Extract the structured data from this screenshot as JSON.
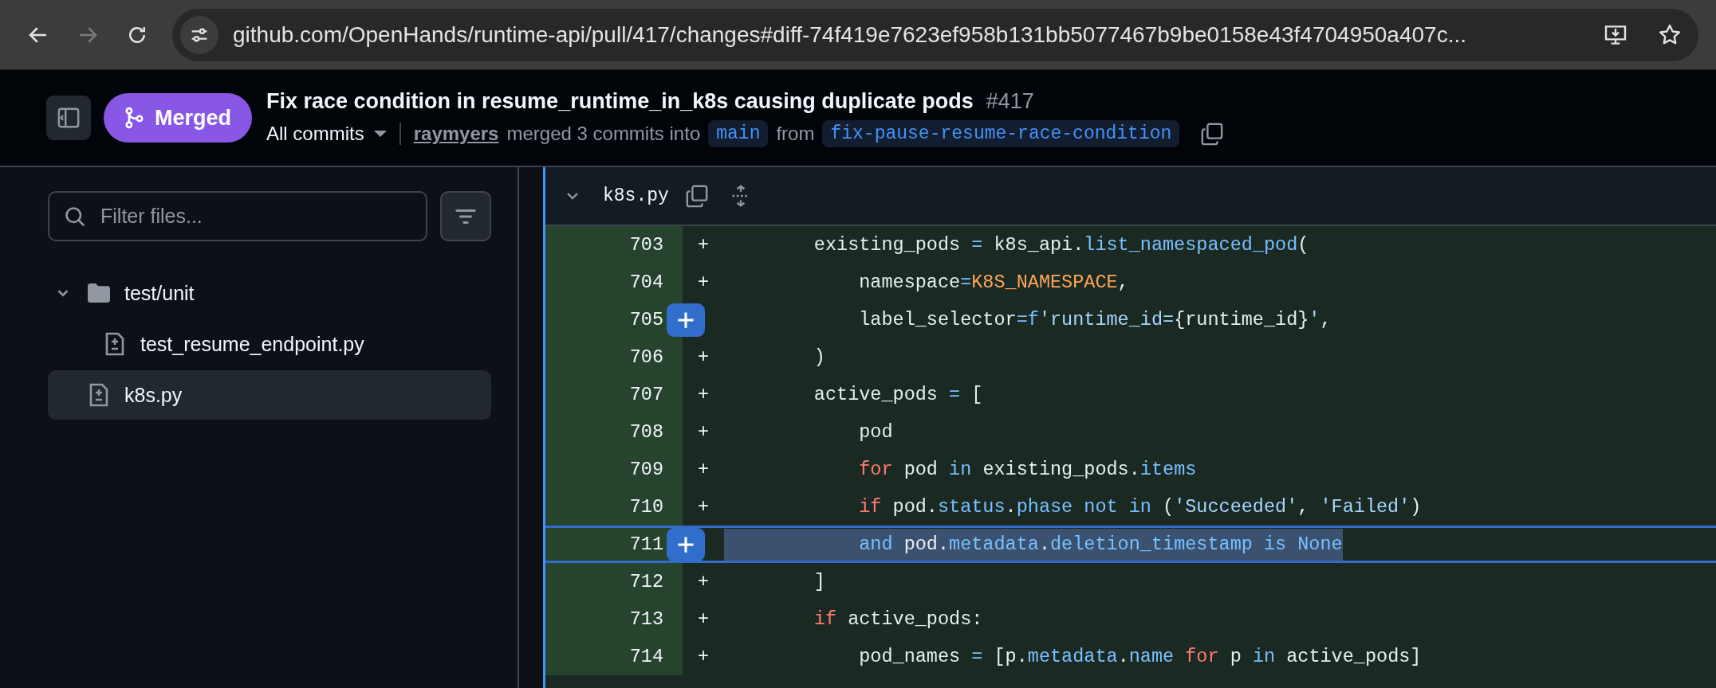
{
  "browser": {
    "nav_buttons": [
      {
        "kind": "back",
        "disabled": false
      },
      {
        "kind": "forward",
        "disabled": true
      },
      {
        "kind": "reload",
        "disabled": false
      }
    ],
    "url": "github.com/OpenHands/runtime-api/pull/417/changes#diff-74f419e7623ef958b131bb5077467b9be0158e43f4704950a407c..."
  },
  "pull_request": {
    "state_label": "Merged",
    "title": "Fix race condition in resume_runtime_in_k8s causing duplicate pods",
    "number": "#417",
    "commits_selector": "All commits",
    "author": "raymyers",
    "summary": "merged 3 commits into",
    "base_branch": "main",
    "from_label": "from",
    "head_branch": "fix-pause-resume-race-condition"
  },
  "sidebar": {
    "filter": {
      "placeholder": "Filter files..."
    },
    "tree": [
      {
        "kind": "folder",
        "label": "test/unit",
        "expanded": true,
        "selected": false,
        "children": [
          {
            "kind": "file",
            "label": "test_resume_endpoint.py",
            "selected": false
          }
        ]
      },
      {
        "kind": "file",
        "label": "k8s.py",
        "selected": true
      }
    ]
  },
  "diff": {
    "file_name": "k8s.py",
    "expanded": true,
    "lines": [
      {
        "number": "703",
        "marker": "+",
        "comment_button": false,
        "selected": false,
        "tokens": [
          {
            "kind": "plain",
            "text": "        existing_pods "
          },
          {
            "kind": "operator",
            "text": "="
          },
          {
            "kind": "plain",
            "text": " k8s_api."
          },
          {
            "kind": "name",
            "text": "list_namespaced_pod"
          },
          {
            "kind": "plain",
            "text": "("
          }
        ]
      },
      {
        "number": "704",
        "marker": "+",
        "comment_button": false,
        "selected": false,
        "tokens": [
          {
            "kind": "plain",
            "text": "            namespace"
          },
          {
            "kind": "operator",
            "text": "="
          },
          {
            "kind": "constant",
            "text": "K8S_NAMESPACE"
          },
          {
            "kind": "plain",
            "text": ","
          }
        ]
      },
      {
        "number": "705",
        "comment_button": true,
        "selected": false,
        "tokens": [
          {
            "kind": "plain",
            "text": "            label_selector"
          },
          {
            "kind": "operator",
            "text": "=f"
          },
          {
            "kind": "string",
            "text": "'runtime_id="
          },
          {
            "kind": "plain",
            "text": "{runtime_id}"
          },
          {
            "kind": "string",
            "text": "'"
          },
          {
            "kind": "plain",
            "text": ","
          }
        ]
      },
      {
        "number": "706",
        "marker": "+",
        "comment_button": false,
        "selected": false,
        "tokens": [
          {
            "kind": "plain",
            "text": "        )"
          }
        ]
      },
      {
        "number": "707",
        "marker": "+",
        "comment_button": false,
        "selected": false,
        "tokens": [
          {
            "kind": "plain",
            "text": "        active_pods "
          },
          {
            "kind": "operator",
            "text": "="
          },
          {
            "kind": "plain",
            "text": " ["
          }
        ]
      },
      {
        "number": "708",
        "marker": "+",
        "comment_button": false,
        "selected": false,
        "tokens": [
          {
            "kind": "plain",
            "text": "            pod"
          }
        ]
      },
      {
        "number": "709",
        "marker": "+",
        "comment_button": false,
        "selected": false,
        "tokens": [
          {
            "kind": "keyword",
            "text": "            for"
          },
          {
            "kind": "plain",
            "text": " pod "
          },
          {
            "kind": "operator",
            "text": "in"
          },
          {
            "kind": "plain",
            "text": " existing_pods."
          },
          {
            "kind": "name",
            "text": "items"
          }
        ]
      },
      {
        "number": "710",
        "marker": "+",
        "comment_button": false,
        "selected": false,
        "tokens": [
          {
            "kind": "keyword",
            "text": "            if"
          },
          {
            "kind": "plain",
            "text": " pod."
          },
          {
            "kind": "name",
            "text": "status"
          },
          {
            "kind": "plain",
            "text": "."
          },
          {
            "kind": "name",
            "text": "phase"
          },
          {
            "kind": "operator",
            "text": " not in"
          },
          {
            "kind": "plain",
            "text": " ("
          },
          {
            "kind": "string",
            "text": "'Succeeded'"
          },
          {
            "kind": "plain",
            "text": ", "
          },
          {
            "kind": "string",
            "text": "'Failed'"
          },
          {
            "kind": "plain",
            "text": ")"
          }
        ]
      },
      {
        "number": "711",
        "comment_button": true,
        "selected": true,
        "tokens": [
          {
            "kind": "operator",
            "text": "            and"
          },
          {
            "kind": "plain",
            "text": " pod."
          },
          {
            "kind": "name",
            "text": "metadata"
          },
          {
            "kind": "plain",
            "text": "."
          },
          {
            "kind": "name",
            "text": "deletion_timestamp"
          },
          {
            "kind": "operator",
            "text": " is None"
          }
        ]
      },
      {
        "number": "712",
        "marker": "+",
        "comment_button": false,
        "selected": false,
        "tokens": [
          {
            "kind": "plain",
            "text": "        ]"
          }
        ]
      },
      {
        "number": "713",
        "marker": "+",
        "comment_button": false,
        "selected": false,
        "tokens": [
          {
            "kind": "keyword",
            "text": "        if"
          },
          {
            "kind": "plain",
            "text": " active_pods:"
          }
        ]
      },
      {
        "number": "714",
        "marker": "+",
        "comment_button": false,
        "selected": false,
        "tokens": [
          {
            "kind": "plain",
            "text": "            pod_names "
          },
          {
            "kind": "operator",
            "text": "="
          },
          {
            "kind": "plain",
            "text": " [p."
          },
          {
            "kind": "name",
            "text": "metadata"
          },
          {
            "kind": "plain",
            "text": "."
          },
          {
            "kind": "name",
            "text": "name"
          },
          {
            "kind": "keyword",
            "text": " for"
          },
          {
            "kind": "plain",
            "text": " p "
          },
          {
            "kind": "operator",
            "text": "in"
          },
          {
            "kind": "plain",
            "text": " active_pods]"
          }
        ]
      }
    ]
  }
}
